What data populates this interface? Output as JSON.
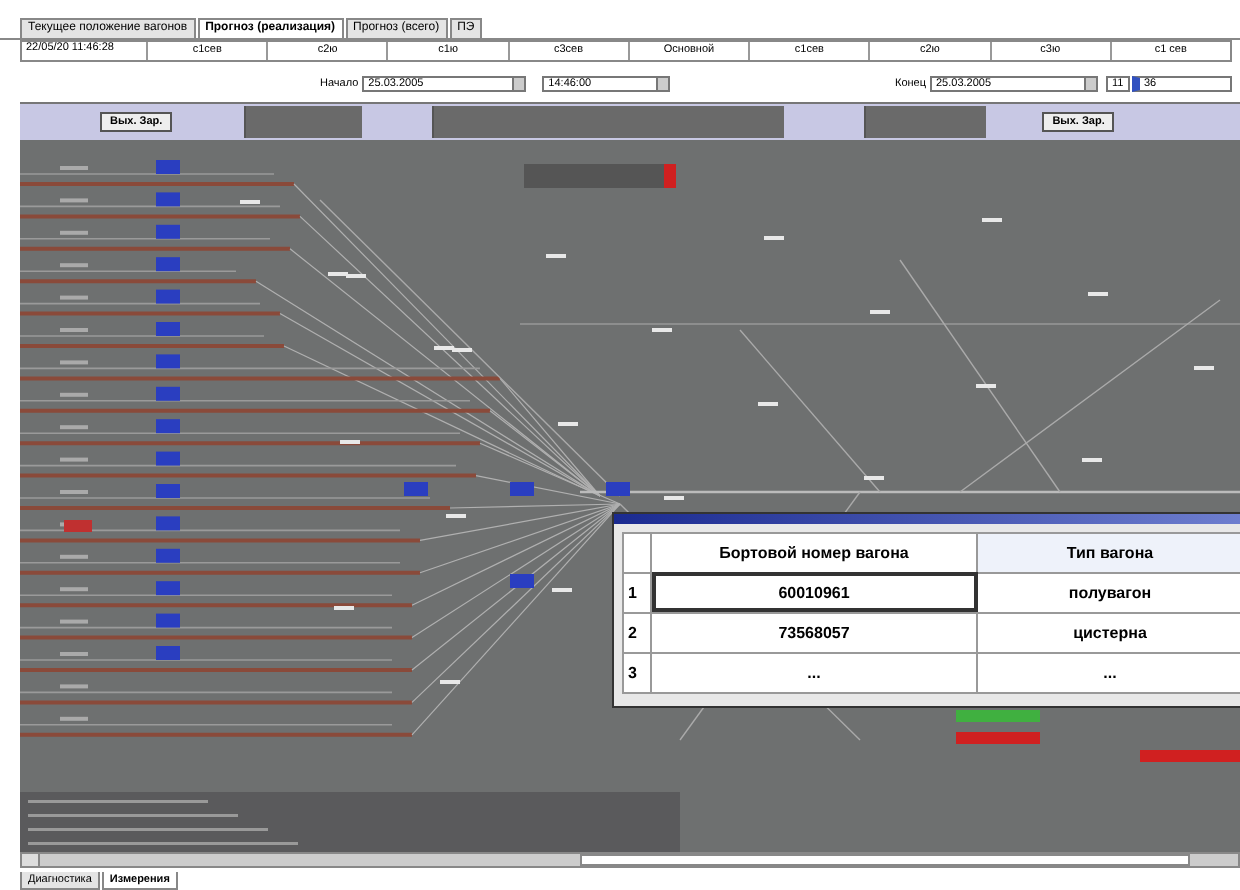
{
  "tabs": [
    {
      "label": "Текущее положение вагонов",
      "selected": false
    },
    {
      "label": "Прогноз (реализация)",
      "selected": true
    },
    {
      "label": "Прогноз (всего)",
      "selected": false
    },
    {
      "label": "ПЭ",
      "selected": false
    }
  ],
  "header": {
    "clock": "22/05/20 11:46:28",
    "columns": [
      "с1сев",
      "с2ю",
      "с1ю",
      "с3сев",
      "Основной",
      "с1сев",
      "с2ю",
      "с3ю",
      "с1 сев"
    ]
  },
  "range": {
    "start_label": "Начало",
    "start_date": "25.03.2005",
    "start_time": "14:46:00",
    "end_label": "Конец",
    "end_date": "25.03.2005",
    "end_hour": "11",
    "end_minute": "36"
  },
  "toolbar": {
    "buttons": [
      "Вых. Зар.",
      "Вых. Зар."
    ]
  },
  "wagon_table": {
    "columns": [
      "Бортовой номер вагона",
      "Тип вагона"
    ],
    "rows": [
      {
        "index": "1",
        "cells": [
          "60010961",
          "полувагон"
        ]
      },
      {
        "index": "2",
        "cells": [
          "73568057",
          "цистерна"
        ]
      },
      {
        "index": "3",
        "cells": [
          "...",
          "..."
        ]
      }
    ]
  },
  "bottom_tabs": [
    {
      "label": "Диагностика",
      "selected": false
    },
    {
      "label": "Измерения",
      "selected": true
    }
  ]
}
